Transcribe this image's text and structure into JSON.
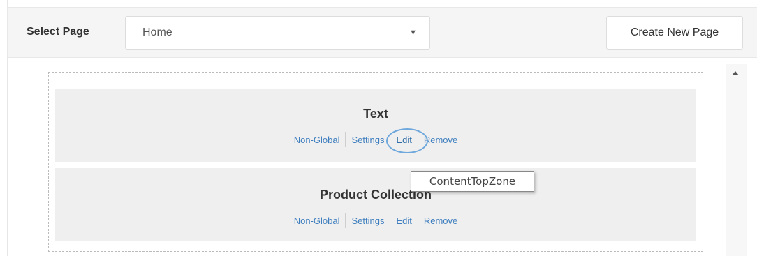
{
  "header": {
    "select_label": "Select Page",
    "selected_page": "Home",
    "create_button": "Create New Page"
  },
  "widgets": [
    {
      "title": "Text",
      "actions": [
        "Non-Global",
        "Settings",
        "Edit",
        "Remove"
      ]
    },
    {
      "title": "Product Collection",
      "actions": [
        "Non-Global",
        "Settings",
        "Edit",
        "Remove"
      ]
    }
  ],
  "tooltip": "ContentTopZone",
  "colors": {
    "link": "#3f7fbf",
    "widget_bg": "#efefef",
    "highlight_circle": "#6fa8dc"
  }
}
